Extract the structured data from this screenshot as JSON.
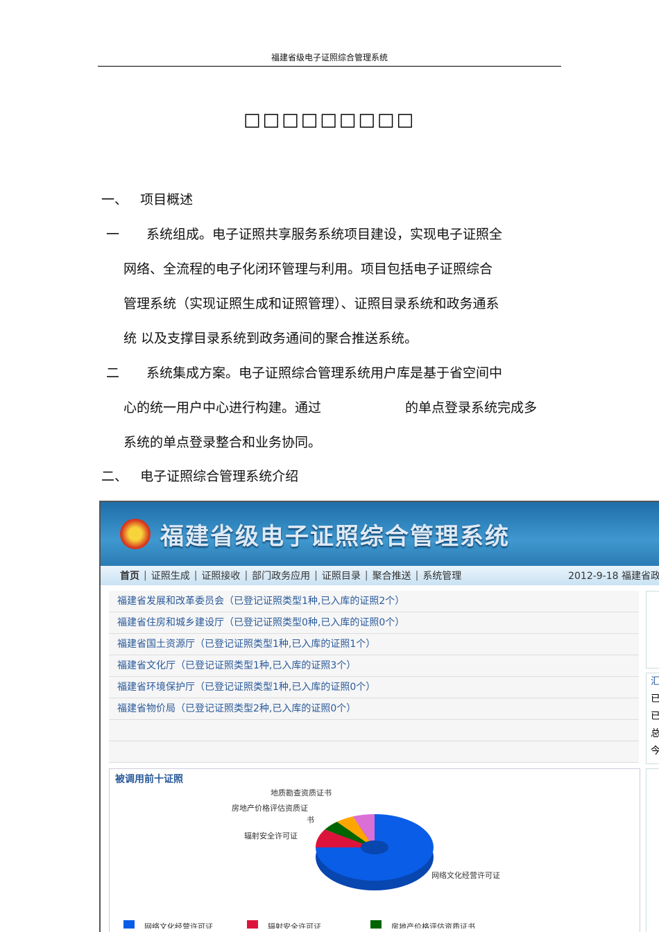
{
  "header": "福建省级电子证照综合管理系统",
  "title": "□□□□□□□□□",
  "s1": {
    "num": "一、",
    "label": "项目概述"
  },
  "p1": {
    "num": "一",
    "lines": [
      "系统组成。电子证照共享服务系统项目建设，实现电子证照全",
      "网络、全流程的电子化闭环管理与利用。项目包括电子证照综合",
      "管理系统（实现证照生成和证照管理）、证照目录系统和政务通系",
      "统 以及支撑目录系统到政务通间的聚合推送系统。"
    ]
  },
  "p2": {
    "num": "二",
    "lines": [
      "系统集成方案。电子证照综合管理系统用户库是基于省空间中",
      "心的统一用户中心进行构建。通过",
      "的单点登录系统完成多",
      "系统的单点登录整合和业务协同。"
    ]
  },
  "s2": {
    "num": "二、",
    "label": "电子证照综合管理系统介绍"
  },
  "app": {
    "title": "福建省级电子证照综合管理系统",
    "nav": [
      "首页",
      "证照生成",
      "证照接收",
      "部门政务应用",
      "证照目录",
      "聚合推送",
      "系统管理"
    ],
    "date": "2012-9-18 福建省政",
    "rows": [
      "福建省发展和改革委员会（已登记证照类型1种,已入库的证照2个）",
      "福建省住房和城乡建设厅（已登记证照类型0种,已入库的证照0个）",
      "福建省国土资源厅（已登记证照类型1种,已入库的证照1个）",
      "福建省文化厅（已登记证照类型1种,已入库的证照3个）",
      "福建省环境保护厅（已登记证照类型1种,已入库的证照0个）",
      "福建省物价局（已登记证照类型2种,已入库的证照0个）"
    ],
    "side": [
      "汇",
      "已",
      "已",
      "总",
      "今"
    ],
    "panel_title": "被调用前十证照"
  },
  "chart_data": {
    "type": "pie",
    "title": "被调用前十证照",
    "slices": [
      {
        "name": "网络文化经营许可证",
        "value": 75,
        "color": "#0a5de6"
      },
      {
        "name": "辐射安全许可证",
        "value": 9,
        "color": "#dc143c"
      },
      {
        "name": "房地产价格评估资质证书",
        "value": 5,
        "color": "#006400"
      },
      {
        "name": "地质勘查资质证书",
        "value": 5,
        "color": "#ffa500"
      },
      {
        "name": "",
        "value": 6,
        "color": "#da70d6"
      }
    ],
    "labels": [
      "地质勘查资质证书",
      "房地产价格评估资质证",
      "书",
      "辐射安全许可证",
      "网络文化经营许可证"
    ],
    "legend": [
      "网络文化经营许可证",
      "辐射安全许可证",
      "房地产价格评估资质证书"
    ]
  }
}
